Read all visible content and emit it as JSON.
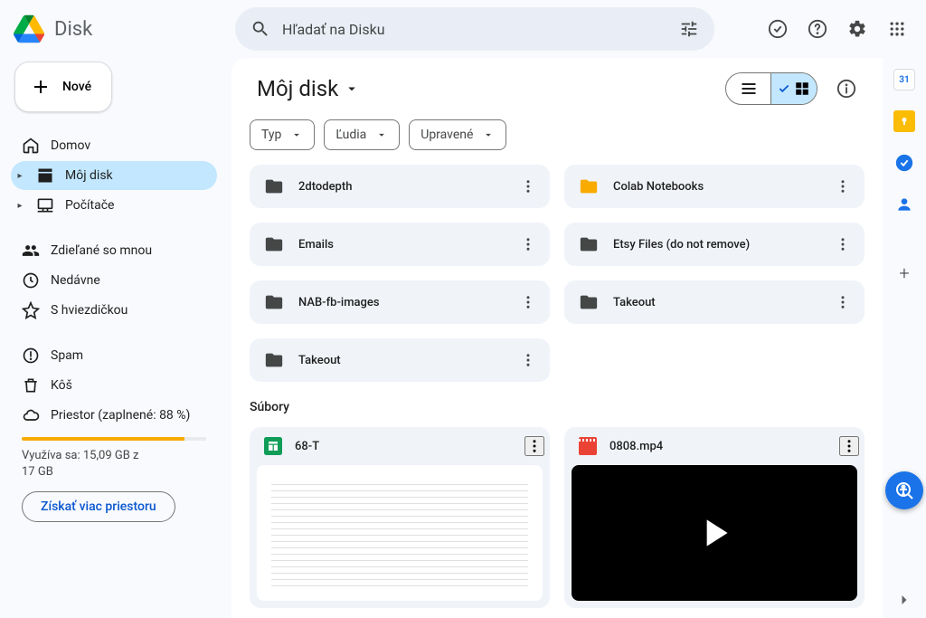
{
  "app": {
    "name": "Disk"
  },
  "search": {
    "placeholder": "Hľadať na Disku"
  },
  "sidebar": {
    "new_label": "Nové",
    "items": [
      {
        "label": "Domov"
      },
      {
        "label": "Môj disk"
      },
      {
        "label": "Počítače"
      },
      {
        "label": "Zdieľané so mnou"
      },
      {
        "label": "Nedávne"
      },
      {
        "label": "S hviezdičkou"
      },
      {
        "label": "Spam"
      },
      {
        "label": "Kôš"
      },
      {
        "label": "Priestor (zaplnené: 88 %)"
      }
    ],
    "storage": {
      "percent": 88,
      "text_line1": "Využíva sa: 15,09 GB z",
      "text_line2": "17 GB",
      "button": "Získať viac priestoru"
    }
  },
  "main": {
    "title": "Môj disk",
    "filters": {
      "type": "Typ",
      "people": "Ľudia",
      "modified": "Upravené"
    },
    "section_files": "Súbory",
    "folders": [
      {
        "name": "2dtodepth",
        "shared": false
      },
      {
        "name": "Colab Notebooks",
        "shared": true
      },
      {
        "name": "Emails",
        "shared": false
      },
      {
        "name": "Etsy Files (do not remove)",
        "shared": false
      },
      {
        "name": "NAB-fb-images",
        "shared": false
      },
      {
        "name": "Takeout",
        "shared": false
      },
      {
        "name": "Takeout",
        "shared": false
      }
    ],
    "files": [
      {
        "name": "68-T",
        "type": "sheets"
      },
      {
        "name": "0808.mp4",
        "type": "video"
      }
    ]
  }
}
